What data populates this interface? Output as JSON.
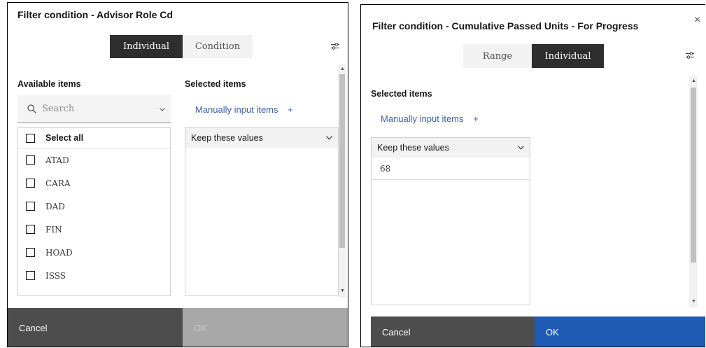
{
  "dialog1": {
    "title": "Filter condition - Advisor Role Cd",
    "tabs": {
      "individual": "Individual",
      "condition": "Condition",
      "active": "Individual"
    },
    "available_label": "Available items",
    "selected_label": "Selected items",
    "search_placeholder": "Search",
    "manual_input_label": "Manually input items",
    "plus": "+",
    "keep_values_label": "Keep these values",
    "select_all_label": "Select all",
    "items": [
      "ATAD",
      "CARA",
      "DAD",
      "FIN",
      "HOAD",
      "ISSS"
    ],
    "cancel_label": "Cancel",
    "ok_label": "OK",
    "ok_enabled": false
  },
  "dialog2": {
    "title": "Filter condition - Cumulative Passed Units - For Progress",
    "close_glyph": "×",
    "tabs": {
      "range": "Range",
      "individual": "Individual",
      "active": "Individual"
    },
    "selected_label": "Selected items",
    "manual_input_label": "Manually input items",
    "plus": "+",
    "keep_values_label": "Keep these values",
    "selected_values": [
      "68"
    ],
    "cancel_label": "Cancel",
    "ok_label": "OK",
    "ok_enabled": true
  },
  "colors": {
    "segment_active": "#2e2e2e",
    "segment_inactive": "#f2f2f2",
    "link": "#3d5fa8",
    "cancel_bg": "#4d4d4d",
    "ok_disabled_bg": "#a8a8a8",
    "ok_primary_bg": "#1f5bb5"
  },
  "icons": {
    "search": "search-icon",
    "chevron": "chevron-down-icon",
    "settings": "filter-settings-icon",
    "close": "close-icon"
  }
}
